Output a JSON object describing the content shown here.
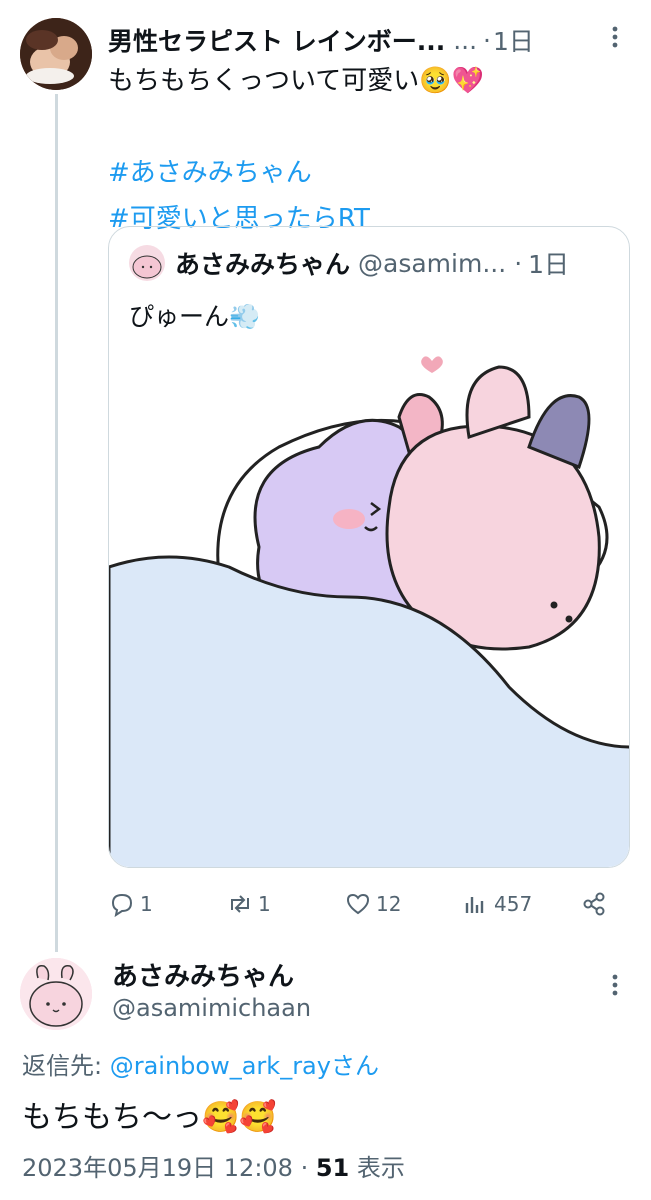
{
  "parent_tweet": {
    "display_name": "男性セラピスト レインボー...",
    "ellipsis": "...",
    "dot": "·",
    "time": "1日",
    "text_line": "もちもちくっついて可愛い🥹💖",
    "hashtags": [
      "#あさみみちゃん",
      "#可愛いと思ったらRT"
    ],
    "quote": {
      "display_name": "あさみみちゃん",
      "handle": "@asamim...",
      "dot": "·",
      "time": "1日",
      "text": "ぴゅーん💨"
    },
    "actions": {
      "replies": "1",
      "retweets": "1",
      "likes": "12",
      "views": "457"
    }
  },
  "reply_tweet": {
    "display_name": "あさみみちゃん",
    "handle": "@asamimichaan",
    "reply_to_prefix": "返信先: ",
    "reply_to_link": "@rainbow_ark_ray",
    "reply_to_suffix": "さん",
    "text": "もちもち〜っ🥰🥰",
    "date": "2023年05月19日 12:08 · ",
    "view_count": "51",
    "view_label": " 表示"
  },
  "colors": {
    "link": "#1d9bf0",
    "muted": "#536471",
    "border": "#cfd9de"
  }
}
